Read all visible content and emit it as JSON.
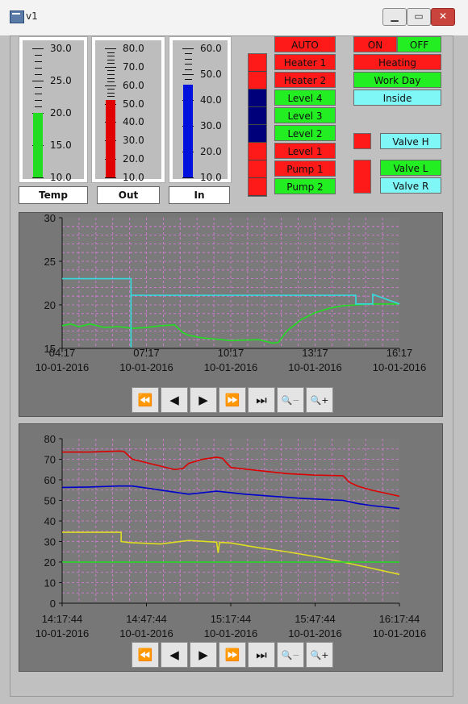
{
  "window": {
    "title": "v1"
  },
  "thermometers": [
    {
      "label": "Temp",
      "min": 10,
      "max": 30,
      "value": 20,
      "color": "#22dd22",
      "tick_labels": [
        "30.0",
        "25.0",
        "20.0",
        "15.0",
        "10.0"
      ]
    },
    {
      "label": "Out",
      "min": 10,
      "max": 80,
      "value": 52,
      "color": "#e00000",
      "tick_labels": [
        "80.0",
        "70.0",
        "60.0",
        "50.0",
        "40.0",
        "30.0",
        "20.0",
        "10.0"
      ]
    },
    {
      "label": "In",
      "min": 10,
      "max": 60,
      "value": 46,
      "color": "#0010dd",
      "tick_labels": [
        "60.0",
        "50.0",
        "40.0",
        "30.0",
        "20.0",
        "10.0"
      ]
    }
  ],
  "status_strip_colors": [
    "#ff1a1a",
    "#ff1a1a",
    "#00007a",
    "#00007a",
    "#00007a",
    "#ff1a1a",
    "#ff1a1a",
    "#ff1a1a"
  ],
  "outputs": [
    {
      "label": "AUTO",
      "color": "red"
    },
    {
      "label": "Heater 1",
      "color": "red"
    },
    {
      "label": "Heater 2",
      "color": "red"
    },
    {
      "label": "Level 4",
      "color": "green"
    },
    {
      "label": "Level 3",
      "color": "green"
    },
    {
      "label": "Level 2",
      "color": "green"
    },
    {
      "label": "Level 1",
      "color": "red"
    },
    {
      "label": "Pump 1",
      "color": "red"
    },
    {
      "label": "Pump 2",
      "color": "green"
    }
  ],
  "mode": {
    "on_label": "ON",
    "off_label": "OFF",
    "heating_label": "Heating",
    "workday_label": "Work Day",
    "inside_label": "Inside"
  },
  "valves": [
    {
      "label": "Valve H"
    },
    {
      "label": "Valve L"
    },
    {
      "label": "Valve R"
    }
  ],
  "nav_icons": [
    "rewind-icon",
    "step-back-icon",
    "play-icon",
    "fast-forward-icon",
    "end-icon",
    "zoom-out-icon",
    "zoom-in-icon"
  ],
  "chart_data": [
    {
      "type": "line",
      "title": "",
      "x_tick_labels": [
        {
          "time": "04:17",
          "date": "10-01-2016"
        },
        {
          "time": "07:17",
          "date": "10-01-2016"
        },
        {
          "time": "10:17",
          "date": "10-01-2016"
        },
        {
          "time": "13:17",
          "date": "10-01-2016"
        },
        {
          "time": "16:17",
          "date": "10-01-2016"
        }
      ],
      "xlim": [
        0,
        12
      ],
      "ylim": [
        15,
        30
      ],
      "y_ticks": [
        15,
        20,
        25,
        30
      ],
      "grid": true,
      "series": [
        {
          "color": "#22dd22",
          "x": [
            0,
            0.3,
            0.6,
            1,
            1.5,
            2,
            2.5,
            3,
            3.5,
            4,
            4.3,
            4.5,
            5,
            6,
            7,
            7.5,
            7.7,
            8,
            8.5,
            9,
            9.5,
            10,
            10.5,
            11,
            11.5,
            12
          ],
          "y": [
            17.6,
            17.8,
            17.5,
            17.8,
            17.4,
            17.5,
            17.3,
            17.4,
            17.6,
            17.7,
            16.8,
            16.5,
            16.2,
            15.9,
            16.0,
            15.6,
            15.7,
            17.0,
            18.3,
            19.1,
            19.6,
            19.9,
            20.0,
            20.1,
            20.1,
            20.1
          ]
        },
        {
          "color": "#33dddd",
          "x": [
            0,
            2.45,
            2.45,
            2.45,
            2.45,
            10.45,
            10.45,
            10.45,
            11,
            11.05,
            11.05,
            12
          ],
          "y": [
            23,
            23,
            15.1,
            21.1,
            21.1,
            21.1,
            20.1,
            20.1,
            20.1,
            20.1,
            21.2,
            20.1
          ]
        }
      ]
    },
    {
      "type": "line",
      "title": "",
      "x_tick_labels": [
        {
          "time": "14:17:44",
          "date": "10-01-2016"
        },
        {
          "time": "14:47:44",
          "date": "10-01-2016"
        },
        {
          "time": "15:17:44",
          "date": "10-01-2016"
        },
        {
          "time": "15:47:44",
          "date": "10-01-2016"
        },
        {
          "time": "16:17:44",
          "date": "10-01-2016"
        }
      ],
      "xlim": [
        0,
        120
      ],
      "ylim": [
        0,
        80
      ],
      "y_ticks": [
        0,
        10,
        20,
        30,
        40,
        50,
        60,
        70,
        80
      ],
      "grid": true,
      "series": [
        {
          "color": "#dd0000",
          "x": [
            0,
            10,
            20,
            22,
            25,
            40,
            43,
            45,
            50,
            55,
            57,
            60,
            70,
            80,
            90,
            100,
            102,
            105,
            110,
            120
          ],
          "y": [
            73.5,
            73.5,
            74,
            73.8,
            70,
            65,
            65.5,
            68,
            70,
            71,
            70.5,
            66,
            64.5,
            63,
            62.3,
            62,
            59,
            57,
            55,
            52
          ]
        },
        {
          "color": "#0000cc",
          "x": [
            0,
            10,
            20,
            25,
            30,
            45,
            55,
            65,
            75,
            85,
            95,
            100,
            105,
            110,
            120
          ],
          "y": [
            56.3,
            56.5,
            57,
            57,
            56,
            53,
            54.5,
            53,
            52,
            51,
            50.3,
            50,
            48.5,
            47.5,
            46
          ]
        },
        {
          "color": "#dddd22",
          "x": [
            0,
            10,
            21,
            21,
            24,
            35,
            45,
            55,
            55.5,
            56,
            60,
            70,
            80,
            90,
            100,
            110,
            120
          ],
          "y": [
            34.5,
            34.5,
            34.5,
            30,
            29.5,
            28.8,
            30.5,
            29.7,
            24.5,
            29.6,
            29.3,
            27,
            25,
            22.7,
            20,
            17,
            14
          ]
        },
        {
          "color": "#22dd22",
          "x": [
            0,
            120
          ],
          "y": [
            20,
            20
          ]
        }
      ]
    }
  ]
}
